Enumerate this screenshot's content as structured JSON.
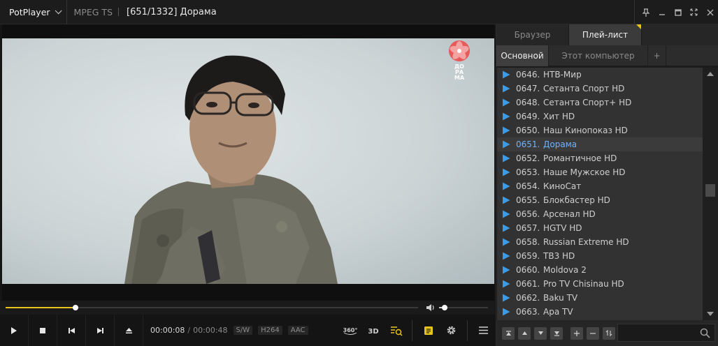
{
  "app": {
    "name": "PotPlayer",
    "format": "MPEG TS",
    "title": "[651/1332]  Дорама"
  },
  "video": {
    "channel_logo_text": "ДОРАМА"
  },
  "playback": {
    "current_time": "00:00:08",
    "separator": "/",
    "total_time": "00:00:48",
    "progress_fraction": 0.17,
    "volume_fraction": 0.05,
    "tags": [
      "S/W",
      "H264",
      "AAC"
    ]
  },
  "panel": {
    "tabs": [
      {
        "label": "Браузер",
        "active": false
      },
      {
        "label": "Плей-лист",
        "active": true
      }
    ],
    "subtabs": [
      {
        "label": "Основной",
        "active": true
      },
      {
        "label": "Этот компьютер",
        "active": false
      },
      {
        "label": "+",
        "active": false
      }
    ],
    "playlist": [
      {
        "num": "0646.",
        "name": "НТВ-Мир"
      },
      {
        "num": "0647.",
        "name": "Сетанта Спорт HD"
      },
      {
        "num": "0648.",
        "name": "Сетанта Спорт+ HD"
      },
      {
        "num": "0649.",
        "name": "Хит HD"
      },
      {
        "num": "0650.",
        "name": "Наш Кинопоказ HD"
      },
      {
        "num": "0651.",
        "name": "Дорама",
        "selected": true
      },
      {
        "num": "0652.",
        "name": "Романтичное HD"
      },
      {
        "num": "0653.",
        "name": "Наше Мужское HD"
      },
      {
        "num": "0654.",
        "name": "КиноСат"
      },
      {
        "num": "0655.",
        "name": "Блокбастер HD"
      },
      {
        "num": "0656.",
        "name": "Арсенал HD"
      },
      {
        "num": "0657.",
        "name": "HGTV HD"
      },
      {
        "num": "0658.",
        "name": "Russian Extreme HD"
      },
      {
        "num": "0659.",
        "name": "ТВ3 HD"
      },
      {
        "num": "0660.",
        "name": "Moldova 2"
      },
      {
        "num": "0661.",
        "name": "Pro TV Chisinau HD"
      },
      {
        "num": "0662.",
        "name": "Baku TV"
      },
      {
        "num": "0663.",
        "name": "Apa TV"
      }
    ]
  },
  "colors": {
    "accent": "#e8c41b",
    "selected_text": "#6fb3ff",
    "play_icon": "#3a9be8"
  }
}
